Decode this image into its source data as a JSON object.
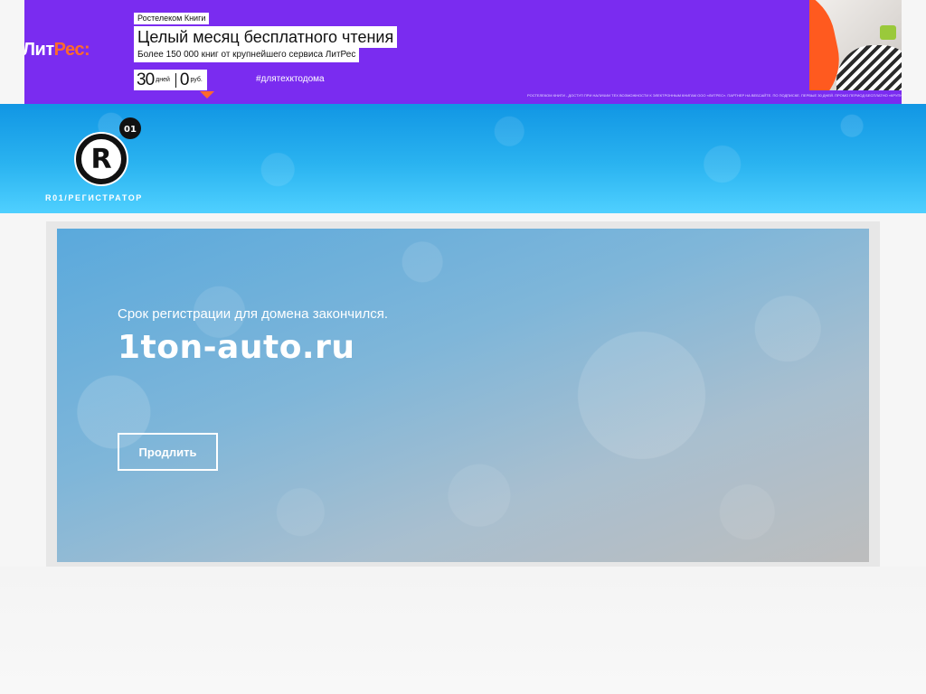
{
  "ad": {
    "brand_prefix": "Лит",
    "brand_suffix": "Рес:",
    "tag": "Ростелеком Книги",
    "headline": "Целый месяц бесплатного чтения",
    "subline": "Более 150 000 книг от крупнейшего сервиса ЛитРес",
    "offer_days_number": "30",
    "offer_days_unit": "дней",
    "offer_price_number": "0",
    "offer_price_unit": "руб.",
    "hashtag": "#длятехктодома",
    "fine_print": "РОСТЕЛЕКОМ КНИГИ - ДОСТУП ПРИ НАЛИЧИИ ТЕХ ВОЗМОЖНОСТИ К ЭЛЕКТРОННЫМ КНИГАМ ООО «ЛИТРЕС». ПАРТНЕР НА ВЕБСАЙТЕ. ПО ПОДПИСКЕ. ПЕРВЫЕ 30 ДНЕЙ. ПРОМО ПЕРИОД БЕСПЛАТНО «КРУПНЕЙШИЙ» ПО ИССЛЕДОВАНИЯМ"
  },
  "header": {
    "logo_letter": "R",
    "logo_badge": "01",
    "logo_text": "R01/РЕГИСТРАТОР"
  },
  "main": {
    "status_text": "Срок регистрации для домена закончился.",
    "domain": "1ton-auto.ru",
    "renew_label": "Продлить"
  },
  "colors": {
    "ad_background": "#7a2cf0",
    "ad_accent": "#ff6a2c",
    "header_top": "#1196e4",
    "header_bottom": "#4fd0ff"
  }
}
